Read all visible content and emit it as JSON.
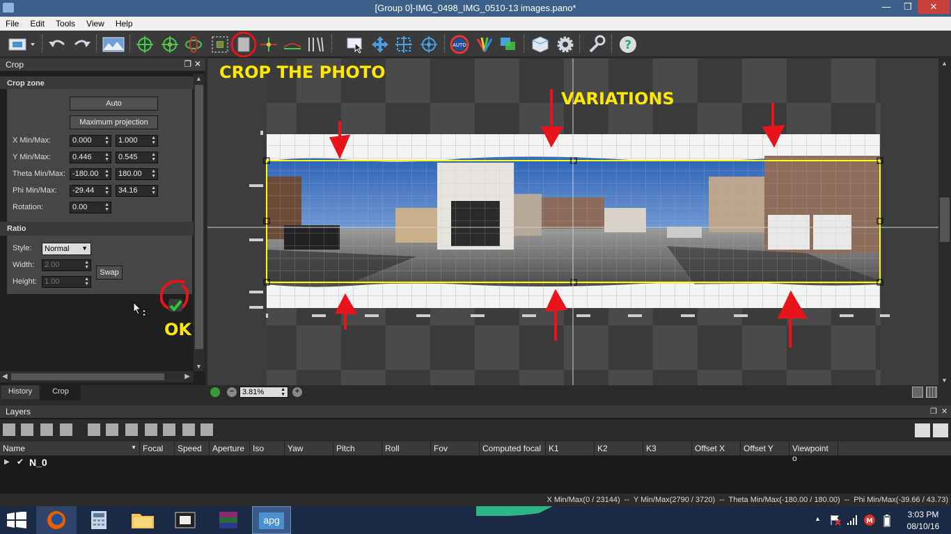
{
  "window": {
    "title": "[Group 0]-IMG_0498_IMG_0510-13 images.pano*"
  },
  "menu": [
    "File",
    "Edit",
    "Tools",
    "View",
    "Help"
  ],
  "toolbar_icons": [
    "layout-icon",
    "undo-icon",
    "redo-icon",
    "panorama-icon",
    "control-points-icon",
    "target-icon",
    "orbit-icon",
    "mask-icon",
    "crop-icon",
    "split-icon",
    "horizon-icon",
    "lines-icon",
    "select-icon",
    "move-icon",
    "transform-icon",
    "center-icon",
    "auto-color-icon",
    "color-fan-icon",
    "blend-icon",
    "export-icon",
    "settings-icon",
    "wrench-icon",
    "help-icon"
  ],
  "crop_panel": {
    "title": "Crop",
    "zone_title": "Crop zone",
    "auto_label": "Auto",
    "max_proj_label": "Maximum projection",
    "rows": [
      {
        "label": "X Min/Max:",
        "min": "0.000",
        "max": "1.000"
      },
      {
        "label": "Y Min/Max:",
        "min": "0.446",
        "max": "0.545"
      },
      {
        "label": "Theta Min/Max:",
        "min": "-180.00",
        "max": "180.00"
      },
      {
        "label": "Phi Min/Max:",
        "min": "-29.44",
        "max": "34.16"
      }
    ],
    "rotation_label": "Rotation:",
    "rotation_value": "0.00",
    "ratio_title": "Ratio",
    "style_label": "Style:",
    "style_value": "Normal",
    "width_label": "Width:",
    "width_value": "2.00",
    "height_label": "Height:",
    "height_value": "1.00",
    "swap_label": "Swap"
  },
  "left_tabs": [
    "History",
    "Crop"
  ],
  "annotations": {
    "crop": "CROP THE PHOTO",
    "variations": "VARIATIONS",
    "ok": "OK"
  },
  "zoom": {
    "value": "3.81%"
  },
  "layers": {
    "title": "Layers",
    "columns": [
      "Name",
      "Focal",
      "Speed",
      "Aperture",
      "Iso",
      "Yaw",
      "Pitch",
      "Roll",
      "Fov",
      "Computed focal",
      "K1",
      "K2",
      "K3",
      "Offset X",
      "Offset Y",
      "Viewpoint o"
    ],
    "rows": [
      {
        "name": "N_0"
      }
    ]
  },
  "status": {
    "text": "X Min/Max(0 / 23144)  --  Y Min/Max(2790 / 3720)  --  Theta Min/Max(-180.00 / 180.00)  --  Phi Min/Max(-39.66 / 43.73)"
  },
  "taskbar": {
    "time": "3:03 PM",
    "date": "08/10/16",
    "active_app": "apg"
  },
  "colors": {
    "accent": "#ffe800",
    "annotation_red": "#e8131b",
    "crop_frame": "#ffff00"
  }
}
